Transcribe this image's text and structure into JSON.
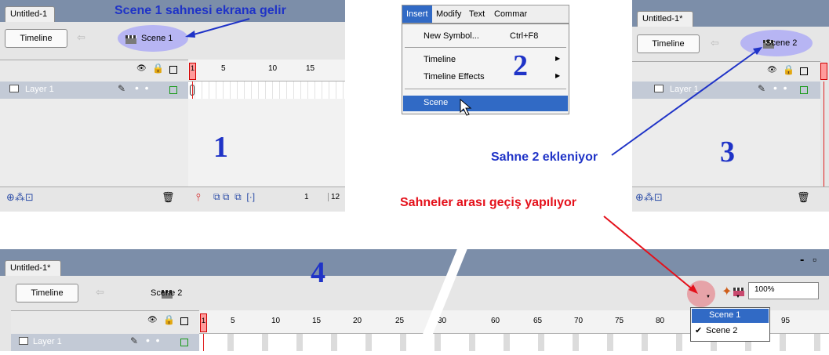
{
  "panel1": {
    "tab": "Untitled-1",
    "timeline_btn": "Timeline",
    "scene": "Scene 1",
    "layer": "Layer 1",
    "ruler": [
      "1",
      "5",
      "10",
      "15"
    ],
    "footer_frame": "1",
    "footer_fps": "12",
    "annotation": "Scene 1 sahnesi ekrana gelir",
    "number": "1"
  },
  "menu": {
    "bar": [
      "Insert",
      "Modify",
      "Text",
      "Commar"
    ],
    "items": [
      {
        "label": "New Symbol...",
        "shortcut": "Ctrl+F8"
      },
      {
        "label": "Timeline",
        "shortcut": ""
      },
      {
        "label": "Timeline Effects",
        "shortcut": ""
      },
      {
        "label": "Scene",
        "shortcut": ""
      }
    ],
    "number": "2"
  },
  "panel3": {
    "tab": "Untitled-1*",
    "timeline_btn": "Timeline",
    "scene": "Scene 2",
    "layer": "Layer 1",
    "annotation": "Sahne 2 ekleniyor",
    "number": "3"
  },
  "panel4": {
    "tab": "Untitled-1*",
    "timeline_btn": "Timeline",
    "scene": "Scene 2",
    "layer": "Layer 1",
    "zoom": "100%",
    "ruler": [
      "1",
      "5",
      "10",
      "15",
      "20",
      "25",
      "30",
      "60",
      "65",
      "70",
      "75",
      "80",
      "95"
    ],
    "dropdown": [
      "Scene 1",
      "Scene 2"
    ],
    "annotation": "Sahneler arası geçiş yapılıyor",
    "number": "4",
    "window_controls": [
      "-",
      "▫"
    ]
  },
  "colors": {
    "annot_blue": "#1f33c7",
    "annot_red": "#e4101a",
    "tab_bar": "#7c8ea9",
    "menu_highlight": "#316ac5"
  },
  "icons": [
    "back-arrow-icon",
    "clapper-icon",
    "eye-icon",
    "lock-icon",
    "outline-icon",
    "pencil-icon",
    "trash-icon",
    "edit-symbols-icon",
    "cursor-icon"
  ]
}
